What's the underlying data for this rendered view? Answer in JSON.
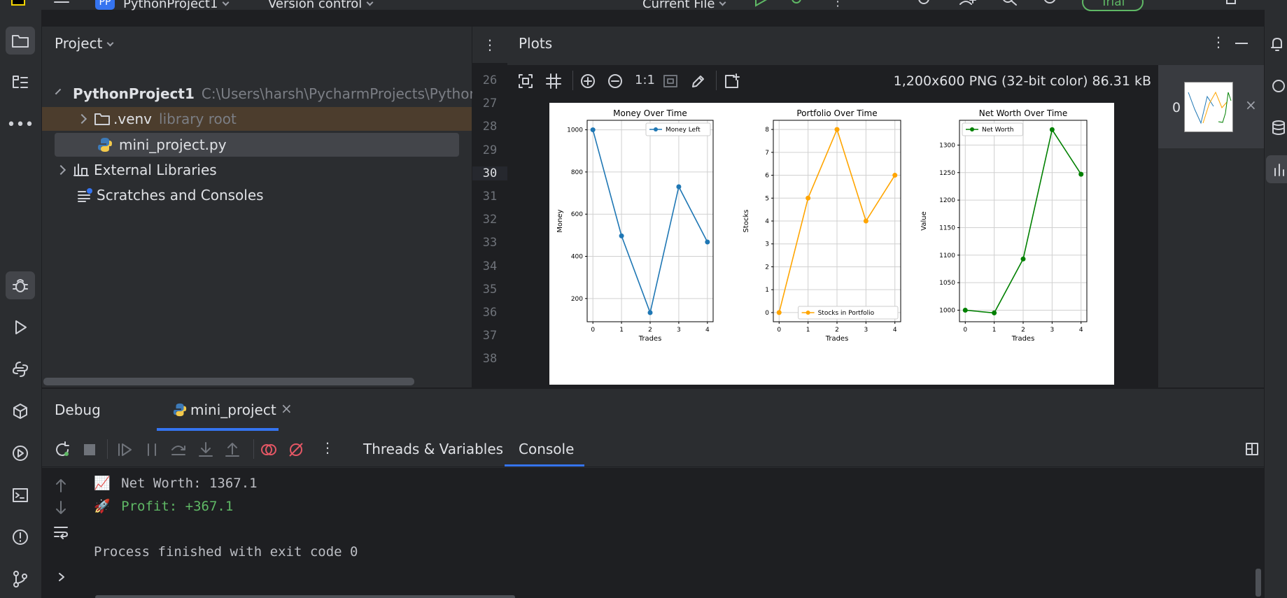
{
  "topbar": {
    "project_badge": "PP",
    "project_name": "PythonProject1",
    "vcs": "Version control",
    "run_config": "Current File",
    "trial": "Trial"
  },
  "project_panel": {
    "title": "Project",
    "tree": [
      {
        "label": "PythonProject1",
        "detail": "C:\\Users\\harsh\\PycharmProjects\\PythonP"
      },
      {
        "label": ".venv",
        "detail": "library root"
      },
      {
        "label": "mini_project.py",
        "detail": ""
      },
      {
        "label": "External Libraries",
        "detail": ""
      },
      {
        "label": "Scratches and Consoles",
        "detail": ""
      }
    ]
  },
  "gutter": {
    "lines": [
      "26",
      "27",
      "28",
      "29",
      "30",
      "31",
      "32",
      "33",
      "34",
      "35",
      "36",
      "37",
      "38"
    ],
    "current_line": "30"
  },
  "plots_panel": {
    "title": "Plots",
    "zoom_label": "1:1",
    "image_info": "1,200x600 PNG (32-bit color) 86.31 kB",
    "thumb_index": "0"
  },
  "chart_data": [
    {
      "type": "line",
      "title": "Money Over Time",
      "xlabel": "Trades",
      "ylabel": "Money",
      "x": [
        0,
        1,
        2,
        3,
        4
      ],
      "series": [
        {
          "name": "Money Left",
          "values": [
            1000,
            497,
            133,
            730,
            468
          ]
        }
      ],
      "xlim": [
        -0.2,
        4.2
      ],
      "ylim": [
        90,
        1045
      ],
      "yticks": [
        200,
        400,
        600,
        800,
        1000
      ],
      "xticks": [
        0,
        1,
        2,
        3,
        4
      ],
      "legend": "upper right",
      "grid": true,
      "color": "#1f77b4"
    },
    {
      "type": "line",
      "title": "Portfolio Over Time",
      "xlabel": "Trades",
      "ylabel": "Stocks",
      "x": [
        0,
        1,
        2,
        3,
        4
      ],
      "series": [
        {
          "name": "Stocks in Portfolio",
          "values": [
            0,
            5,
            8,
            4,
            6
          ]
        }
      ],
      "xlim": [
        -0.2,
        4.2
      ],
      "ylim": [
        -0.4,
        8.4
      ],
      "yticks": [
        0,
        1,
        2,
        3,
        4,
        5,
        6,
        7,
        8
      ],
      "xticks": [
        0,
        1,
        2,
        3,
        4
      ],
      "legend": "lower right",
      "grid": true,
      "color": "#ffa500"
    },
    {
      "type": "line",
      "title": "Net Worth Over Time",
      "xlabel": "Trades",
      "ylabel": "Value",
      "x": [
        0,
        1,
        2,
        3,
        4
      ],
      "series": [
        {
          "name": "Net Worth",
          "values": [
            1000,
            995,
            1093,
            1328,
            1247
          ]
        }
      ],
      "xlim": [
        -0.2,
        4.2
      ],
      "ylim": [
        979,
        1345
      ],
      "yticks": [
        1000,
        1050,
        1100,
        1150,
        1200,
        1250,
        1300
      ],
      "xticks": [
        0,
        1,
        2,
        3,
        4
      ],
      "legend": "upper left",
      "grid": true,
      "color": "#008000"
    }
  ],
  "debug_panel": {
    "title": "Debug",
    "session_tab": "mini_project",
    "tab_threads": "Threads & Variables",
    "tab_console": "Console"
  },
  "console": {
    "net_worth_emoji": "📈",
    "net_worth": "Net Worth: 1367.1",
    "profit_emoji": "🚀",
    "profit": "Profit: +367.1",
    "process": "Process finished with exit code 0",
    "colors": {
      "text": "#bcbec4",
      "profit": "#5fb865"
    }
  }
}
